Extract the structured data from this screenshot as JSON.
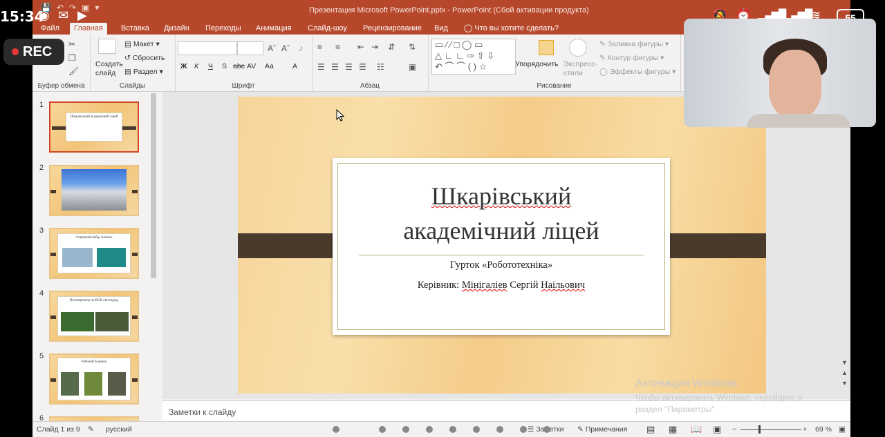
{
  "phone": {
    "time": "15:34",
    "rec_label": "REC",
    "battery": "55"
  },
  "window": {
    "title": "Презентация Microsoft PowerPoint.pptx - PowerPoint (Сбой активации продукта)"
  },
  "tabs": [
    {
      "label": "Файл",
      "active": false
    },
    {
      "label": "Главная",
      "active": true
    },
    {
      "label": "Вставка",
      "active": false
    },
    {
      "label": "Дизайн",
      "active": false
    },
    {
      "label": "Переходы",
      "active": false
    },
    {
      "label": "Анимация",
      "active": false
    },
    {
      "label": "Слайд-шоу",
      "active": false
    },
    {
      "label": "Рецензирование",
      "active": false
    },
    {
      "label": "Вид",
      "active": false
    }
  ],
  "tell_me": "Что вы хотите сделать?",
  "ribbon": {
    "clipboard_label": "Буфер обмена",
    "slides_label": "Слайды",
    "font_label": "Шрифт",
    "paragraph_label": "Абзац",
    "drawing_label": "Рисование",
    "create_slide": "Создать слайд",
    "layout": "Макет",
    "reset": "Сбросить",
    "section": "Раздел",
    "arrange": "Упорядочить",
    "quick_styles": "Экспресс-стили",
    "shape_fill": "Заливка фигуры",
    "shape_outline": "Контур фигуры",
    "shape_effects": "Эффекты фигуры",
    "font_buttons": [
      "Ж",
      "К",
      "Ч",
      "S",
      "abc",
      "AV",
      "Aa",
      "A"
    ]
  },
  "thumbnails": [
    {
      "num": "1",
      "title": "Шкарівський академічний ліцей",
      "selected": true
    },
    {
      "num": "2",
      "title": "",
      "selected": false
    },
    {
      "num": "3",
      "title": "Стартовий набір Arduino",
      "selected": false
    },
    {
      "num": "4",
      "title": "Потенціометр та RGB світлодіод",
      "selected": false
    },
    {
      "num": "5",
      "title": "Робочий будинок",
      "selected": false
    },
    {
      "num": "6",
      "title": "",
      "selected": false
    }
  ],
  "slide": {
    "title_line1": "Шкарівський",
    "title_line2": "академічний ліцей",
    "subtitle1": "Гурток «Робототехніка»",
    "subtitle2_prefix": "Керівник: ",
    "subtitle2_name1": "Мінігаліев",
    "subtitle2_mid": " Сергій ",
    "subtitle2_name2": "Наільович"
  },
  "notes_placeholder": "Заметки к слайду",
  "status": {
    "slide_count": "Слайд 1 из 9",
    "language": "русский",
    "notes_btn": "Заметки",
    "comments_btn": "Примечания",
    "zoom": "69 %"
  },
  "activation": {
    "title": "Активация Windows",
    "text": "Чтобы активировать Windows, перейдите в раздел \"Параметры\"."
  },
  "colors": {
    "accent": "#b7472a",
    "plank": "#4a3a2c",
    "slide_bg": "#f7d49b"
  }
}
